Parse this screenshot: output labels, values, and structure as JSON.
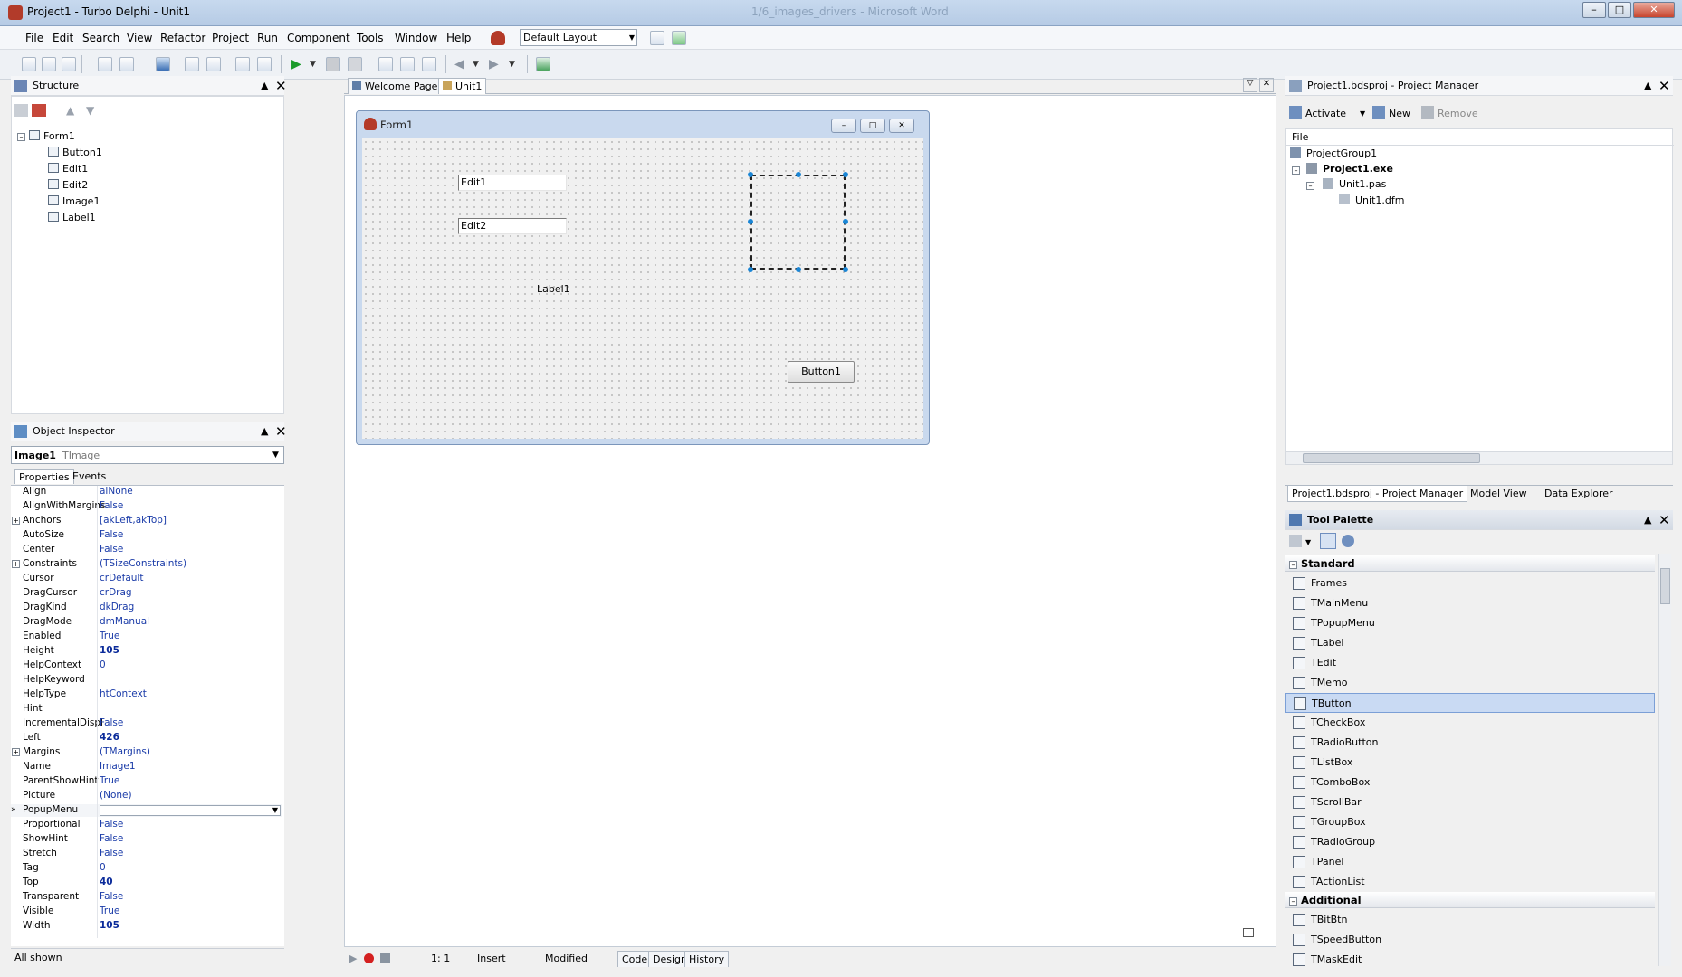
{
  "window": {
    "title": "Project1 - Turbo Delphi - Unit1",
    "background_title": "1/6_images_drivers - Microsoft Word"
  },
  "menu": [
    "File",
    "Edit",
    "Search",
    "View",
    "Refactor",
    "Project",
    "Run",
    "Component",
    "Tools",
    "Window",
    "Help"
  ],
  "layout_select": {
    "value": "Default Layout"
  },
  "structure": {
    "title": "Structure",
    "root": "Form1",
    "children": [
      "Button1",
      "Edit1",
      "Edit2",
      "Image1",
      "Label1"
    ]
  },
  "object_inspector": {
    "title": "Object Inspector",
    "selected_name": "Image1",
    "selected_class": "TImage",
    "tabs": [
      "Properties",
      "Events"
    ],
    "properties": [
      {
        "k": "Align",
        "v": "alNone"
      },
      {
        "k": "AlignWithMargins",
        "v": "False"
      },
      {
        "k": "Anchors",
        "v": "[akLeft,akTop]",
        "expand": true
      },
      {
        "k": "AutoSize",
        "v": "False"
      },
      {
        "k": "Center",
        "v": "False"
      },
      {
        "k": "Constraints",
        "v": "(TSizeConstraints)",
        "expand": true
      },
      {
        "k": "Cursor",
        "v": "crDefault"
      },
      {
        "k": "DragCursor",
        "v": "crDrag"
      },
      {
        "k": "DragKind",
        "v": "dkDrag"
      },
      {
        "k": "DragMode",
        "v": "dmManual"
      },
      {
        "k": "Enabled",
        "v": "True"
      },
      {
        "k": "Height",
        "v": "105",
        "bold": true
      },
      {
        "k": "HelpContext",
        "v": "0"
      },
      {
        "k": "HelpKeyword",
        "v": ""
      },
      {
        "k": "HelpType",
        "v": "htContext"
      },
      {
        "k": "Hint",
        "v": ""
      },
      {
        "k": "IncrementalDispl",
        "v": "False"
      },
      {
        "k": "Left",
        "v": "426",
        "bold": true
      },
      {
        "k": "Margins",
        "v": "(TMargins)",
        "expand": true
      },
      {
        "k": "Name",
        "v": "Image1"
      },
      {
        "k": "ParentShowHint",
        "v": "True"
      },
      {
        "k": "Picture",
        "v": "(None)"
      },
      {
        "k": "PopupMenu",
        "v": "",
        "selected": true
      },
      {
        "k": "Proportional",
        "v": "False"
      },
      {
        "k": "ShowHint",
        "v": "False"
      },
      {
        "k": "Stretch",
        "v": "False"
      },
      {
        "k": "Tag",
        "v": "0"
      },
      {
        "k": "Top",
        "v": "40",
        "bold": true
      },
      {
        "k": "Transparent",
        "v": "False"
      },
      {
        "k": "Visible",
        "v": "True"
      },
      {
        "k": "Width",
        "v": "105",
        "bold": true
      }
    ],
    "footer": "All shown"
  },
  "editor_tabs": [
    "Welcome Page",
    "Unit1"
  ],
  "form": {
    "title": "Form1",
    "edit1": "Edit1",
    "edit2": "Edit2",
    "label1": "Label1",
    "button1": "Button1"
  },
  "status": {
    "position": "1:   1",
    "mode": "Insert",
    "state": "Modified",
    "tabs": [
      "Code",
      "Design",
      "History"
    ]
  },
  "project_manager": {
    "title": "Project1.bdsproj - Project Manager",
    "activate": "Activate",
    "new": "New",
    "remove": "Remove",
    "column": "File",
    "group": "ProjectGroup1",
    "project": "Project1.exe",
    "unit": "Unit1.pas",
    "dfm": "Unit1.dfm",
    "bottom_tabs": [
      "Project1.bdsproj - Project Manager",
      "Model View",
      "Data Explorer"
    ]
  },
  "tool_palette": {
    "title": "Tool Palette",
    "categories": [
      {
        "name": "Standard",
        "items": [
          "Frames",
          "TMainMenu",
          "TPopupMenu",
          "TLabel",
          "TEdit",
          "TMemo",
          "TButton",
          "TCheckBox",
          "TRadioButton",
          "TListBox",
          "TComboBox",
          "TScrollBar",
          "TGroupBox",
          "TRadioGroup",
          "TPanel",
          "TActionList"
        ]
      },
      {
        "name": "Additional",
        "items": [
          "TBitBtn",
          "TSpeedButton",
          "TMaskEdit"
        ]
      }
    ],
    "selected": "TButton"
  }
}
